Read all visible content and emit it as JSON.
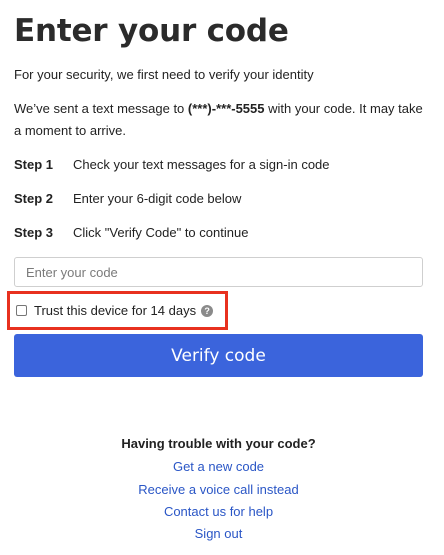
{
  "title": "Enter your code",
  "intro": "For your security, we first need to verify your identity",
  "sent": {
    "prefix": "We’ve sent a text message to ",
    "phone_masked": "(***)-***-",
    "phone_last4": "5555",
    "suffix": " with your code. It may take a moment to arrive."
  },
  "steps": [
    {
      "num": "Step 1",
      "text": "Check your text messages for a sign-in code"
    },
    {
      "num": "Step 2",
      "text": "Enter your 6-digit code below"
    },
    {
      "num": "Step 3",
      "text": "Click \"Verify Code\" to continue"
    }
  ],
  "code_input": {
    "placeholder": "Enter your code",
    "value": ""
  },
  "trust": {
    "label": "Trust this device for 14 days",
    "checked": false,
    "help_icon": "question-circle-icon",
    "highlight_color": "#e8311f"
  },
  "verify_button": {
    "label": "Verify code",
    "color": "#3b64dc"
  },
  "trouble": {
    "heading": "Having trouble with your code?",
    "links": [
      "Get a new code",
      "Receive a voice call instead",
      "Contact us for help",
      "Sign out"
    ],
    "link_color": "#2a56c6"
  }
}
